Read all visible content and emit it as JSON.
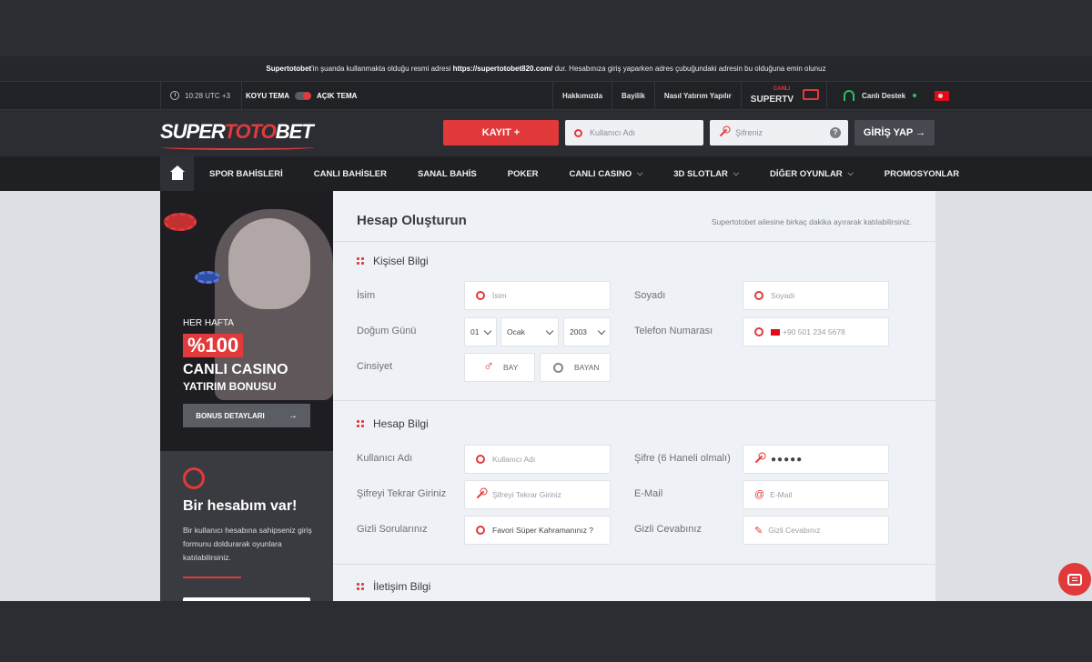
{
  "notice": {
    "brand": "Supertotobet",
    "text1": "'in şuanda kullanmakta olduğu resmi adresi ",
    "url": "https://supertotobet820.com/",
    "text2": " dur. Hesabınıza giriş yaparken adres çubuğundaki adresin bu olduğuna emin olunuz"
  },
  "utilbar": {
    "time": "10:28 UTC +3",
    "theme_dark": "KOYU TEMA",
    "theme_light": "AÇIK TEMA",
    "links": [
      "Hakkımızda",
      "Bayilik",
      "Nasıl Yatırım Yapılır"
    ],
    "supertv_live": "CANLI",
    "supertv_label": "SUPERTV",
    "support": "Canlı Destek"
  },
  "header": {
    "logo_super": "SUPER",
    "logo_toto": "TOTO",
    "logo_bet": "BET",
    "register_label": "KAYIT +",
    "username_placeholder": "Kullanıcı Adı",
    "password_placeholder": "Şifreniz",
    "help": "?",
    "login_label": "GİRİŞ YAP →"
  },
  "nav": {
    "items": [
      {
        "label": "SPOR BAHİSLERİ",
        "chev": ""
      },
      {
        "label": "CANLI BAHİSLER",
        "chev": ""
      },
      {
        "label": "SANAL BAHİS",
        "chev": ""
      },
      {
        "label": "POKER",
        "chev": ""
      },
      {
        "label": "CANLI CASINO",
        "chev": "⌵"
      },
      {
        "label": "3D SLOTLAR",
        "chev": "⌵"
      },
      {
        "label": "DİĞER OYUNLAR",
        "chev": "⌵"
      },
      {
        "label": "PROMOSYONLAR",
        "chev": ""
      }
    ]
  },
  "promo": {
    "line1": "HER HAFTA",
    "percent": "%100",
    "line2": "CANLI CASINO",
    "line3": "YATIRIM BONUSU",
    "button": "BONUS DETAYLARI",
    "arrow": "→"
  },
  "account": {
    "title": "Bir hesabım var!",
    "text": "Bir kullanıcı hesabına sahipseniz giriş formunu doldurarak oyunlara katılabilirsiniz."
  },
  "form": {
    "title": "Hesap Oluşturun",
    "subtitle": "Supertotobet ailesine birkaç dakika ayırarak katılabilirsiniz.",
    "personal": {
      "title": "Kişisel Bilgi",
      "name_label": "İsim",
      "name_placeholder": "İsim",
      "surname_label": "Soyadı",
      "surname_placeholder": "Soyadı",
      "birth_label": "Doğum Günü",
      "day": "01",
      "month": "Ocak",
      "year": "2003",
      "phone_label": "Telefon Numarası",
      "phone_placeholder": "+90 501 234 5678",
      "gender_label": "Cinsiyet",
      "male": "BAY",
      "female": "BAYAN"
    },
    "account": {
      "title": "Hesap Bilgi",
      "username_label": "Kullanıcı Adı",
      "username_placeholder": "Kullanıcı Adı",
      "password_label": "Şifre (6 Haneli olmalı)",
      "password_value": "●●●●●",
      "password2_label": "Şifreyi Tekrar Giriniz",
      "password2_placeholder": "Şifreyi Tekrar Giriniz",
      "email_label": "E-Mail",
      "email_placeholder": "E-Mail",
      "question_label": "Gizli Sorularınız",
      "question_value": "Favori Süper Kahramanınız ?",
      "answer_label": "Gizli Cevabınız",
      "answer_placeholder": "Gizli Cevabınız"
    },
    "contact": {
      "title": "İletişim Bilgi"
    }
  },
  "colors": {
    "accent": "#e23a3a",
    "bg_dark": "#2b2d33",
    "nav": "#1f2024",
    "form_bg": "#eef1f5"
  }
}
